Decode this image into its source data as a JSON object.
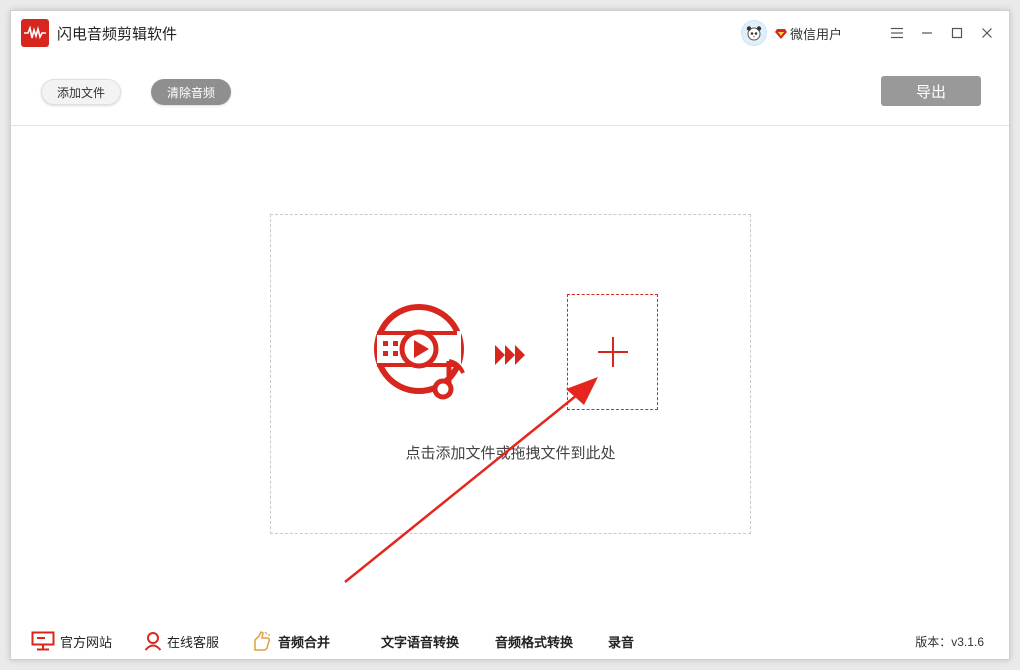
{
  "app": {
    "title": "闪电音频剪辑软件"
  },
  "user": {
    "name": "微信用户"
  },
  "toolbar": {
    "add_file": "添加文件",
    "clear_audio": "清除音频",
    "export": "导出"
  },
  "dropzone": {
    "hint": "点击添加文件或拖拽文件到此处"
  },
  "footer": {
    "website": "官方网站",
    "support": "在线客服",
    "merge": "音频合并",
    "tts": "文字语音转换",
    "format_convert": "音频格式转换",
    "record": "录音",
    "version": "版本：v3.1.6"
  },
  "icons": {
    "app_logo": "waveform-icon",
    "avatar": "panda-avatar-icon",
    "vip": "diamond-icon",
    "menu": "menu-icon",
    "minimize": "minimize-icon",
    "maximize": "maximize-icon",
    "close": "close-icon",
    "music": "music-play-icon",
    "arrows": "forward-arrows-icon",
    "add": "plus-icon",
    "website": "monitor-icon",
    "support": "user-icon",
    "merge": "hand-icon"
  },
  "colors": {
    "accent": "#d7261e",
    "export_bg": "#999999",
    "clear_bg": "#8f8f8f"
  }
}
